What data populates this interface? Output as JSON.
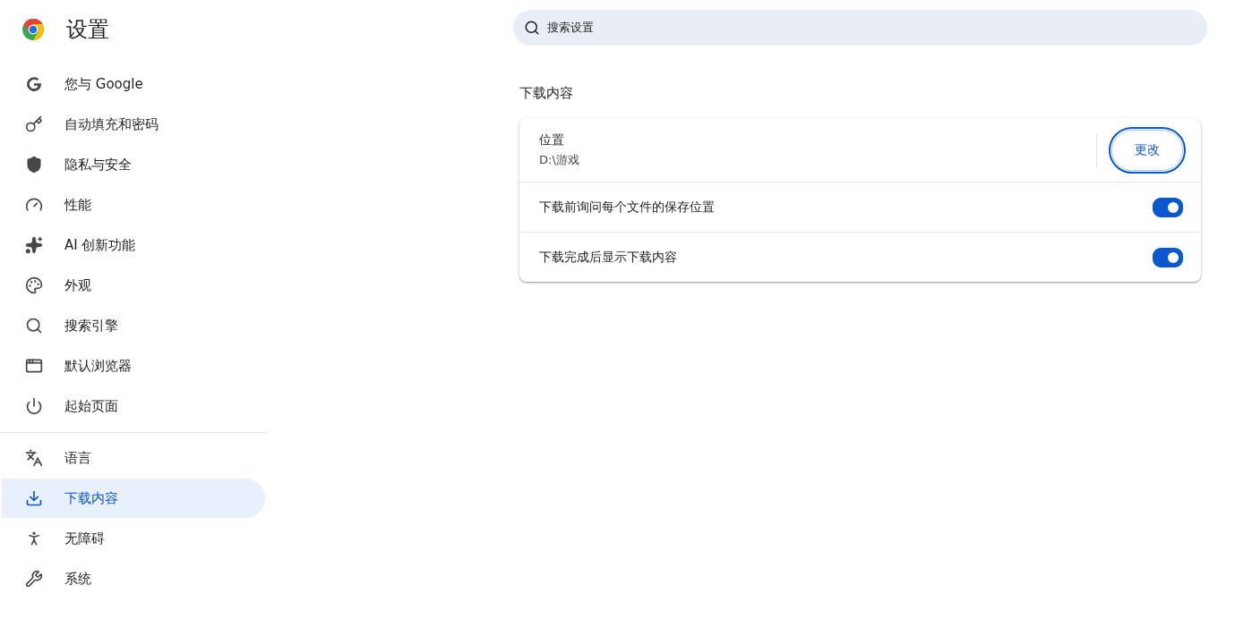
{
  "app": {
    "title": "设置"
  },
  "sidebar": {
    "groups": [
      {
        "items": [
          {
            "label": "您与 Google",
            "selected": false
          },
          {
            "label": "自动填充和密码",
            "selected": false
          },
          {
            "label": "隐私与安全",
            "selected": false
          },
          {
            "label": "性能",
            "selected": false
          },
          {
            "label": "AI 创新功能",
            "selected": false
          },
          {
            "label": "外观",
            "selected": false
          },
          {
            "label": "搜索引擎",
            "selected": false
          },
          {
            "label": "默认浏览器",
            "selected": false
          },
          {
            "label": "起始页面",
            "selected": false
          }
        ]
      },
      {
        "items": [
          {
            "label": "语言",
            "selected": false
          },
          {
            "label": "下载内容",
            "selected": true
          },
          {
            "label": "无障碍",
            "selected": false
          },
          {
            "label": "系统",
            "selected": false
          }
        ]
      }
    ]
  },
  "search": {
    "placeholder": "搜索设置"
  },
  "section": {
    "title": "下载内容",
    "rows": [
      {
        "kind": "location",
        "label": "位置",
        "value": "D:\\游戏",
        "button": "更改"
      },
      {
        "kind": "toggle",
        "label": "下载前询问每个文件的保存位置",
        "on": true
      },
      {
        "kind": "toggle",
        "label": "下载完成后显示下载内容",
        "on": true
      }
    ]
  }
}
